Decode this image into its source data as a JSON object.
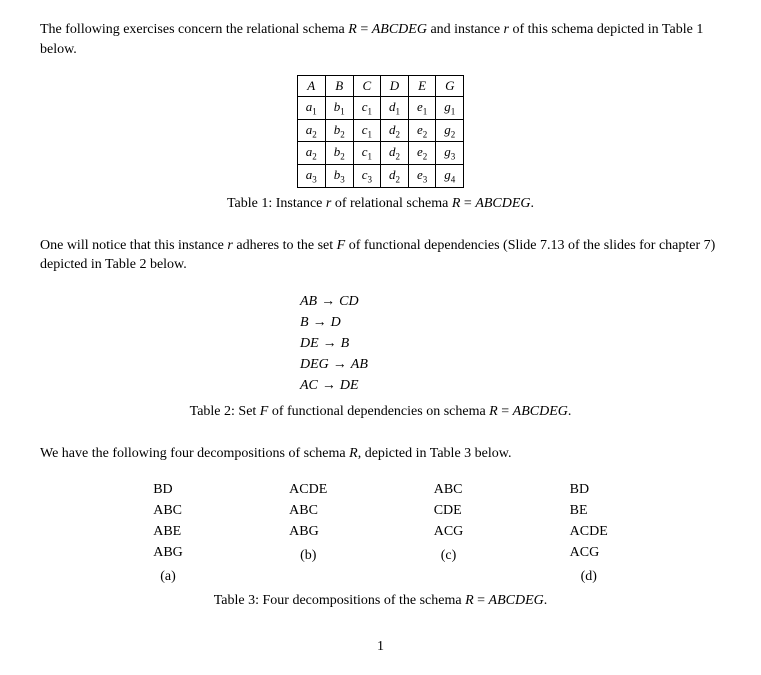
{
  "intro1_a": "The following exercises concern the relational schema ",
  "intro1_R": "R",
  "intro1_eq": " = ",
  "intro1_schema": "ABCDEG",
  "intro1_b": " and instance ",
  "intro1_r": "r",
  "intro1_c": " of this schema depicted in Table 1 below.",
  "table1": {
    "headers": [
      "A",
      "B",
      "C",
      "D",
      "E",
      "G"
    ],
    "rows": [
      [
        [
          "a",
          "1"
        ],
        [
          "b",
          "1"
        ],
        [
          "c",
          "1"
        ],
        [
          "d",
          "1"
        ],
        [
          "e",
          "1"
        ],
        [
          "g",
          "1"
        ]
      ],
      [
        [
          "a",
          "2"
        ],
        [
          "b",
          "2"
        ],
        [
          "c",
          "1"
        ],
        [
          "d",
          "2"
        ],
        [
          "e",
          "2"
        ],
        [
          "g",
          "2"
        ]
      ],
      [
        [
          "a",
          "2"
        ],
        [
          "b",
          "2"
        ],
        [
          "c",
          "1"
        ],
        [
          "d",
          "2"
        ],
        [
          "e",
          "2"
        ],
        [
          "g",
          "3"
        ]
      ],
      [
        [
          "a",
          "3"
        ],
        [
          "b",
          "3"
        ],
        [
          "c",
          "3"
        ],
        [
          "d",
          "2"
        ],
        [
          "e",
          "3"
        ],
        [
          "g",
          "4"
        ]
      ]
    ]
  },
  "caption1_a": "Table 1: Instance ",
  "caption1_r": "r",
  "caption1_b": " of relational schema ",
  "caption1_R": "R",
  "caption1_eq": " = ",
  "caption1_schema": "ABCDEG",
  "caption1_c": ".",
  "intro2_a": "One will notice that this instance ",
  "intro2_r": "r",
  "intro2_b": " adheres to the set ",
  "intro2_F": "F",
  "intro2_c": " of functional dependencies (Slide 7.13 of the slides for chapter 7) depicted in Table 2 below.",
  "fds": [
    {
      "lhs": "AB",
      "rhs": "CD"
    },
    {
      "lhs": "B",
      "rhs": "D"
    },
    {
      "lhs": "DE",
      "rhs": "B"
    },
    {
      "lhs": "DEG",
      "rhs": "AB"
    },
    {
      "lhs": "AC",
      "rhs": "DE"
    }
  ],
  "caption2_a": "Table 2: Set ",
  "caption2_F": "F",
  "caption2_b": " of functional dependencies on schema ",
  "caption2_R": "R",
  "caption2_eq": " = ",
  "caption2_schema": "ABCDEG",
  "caption2_c": ".",
  "intro3_a": "We have the following four decompositions of schema ",
  "intro3_R": "R",
  "intro3_b": ", depicted in Table 3 below.",
  "decomps": [
    {
      "label": "(a)",
      "rows": [
        "BD",
        "ABC",
        "ABE",
        "ABG"
      ]
    },
    {
      "label": "(b)",
      "rows": [
        "ACDE",
        "ABC",
        "ABG"
      ]
    },
    {
      "label": "(c)",
      "rows": [
        "ABC",
        "CDE",
        "ACG"
      ]
    },
    {
      "label": "(d)",
      "rows": [
        "BD",
        "BE",
        "ACDE",
        "ACG"
      ]
    }
  ],
  "caption3_a": "Table 3: Four decompositions of the schema ",
  "caption3_R": "R",
  "caption3_eq": " = ",
  "caption3_schema": "ABCDEG",
  "caption3_c": ".",
  "page_num": "1"
}
